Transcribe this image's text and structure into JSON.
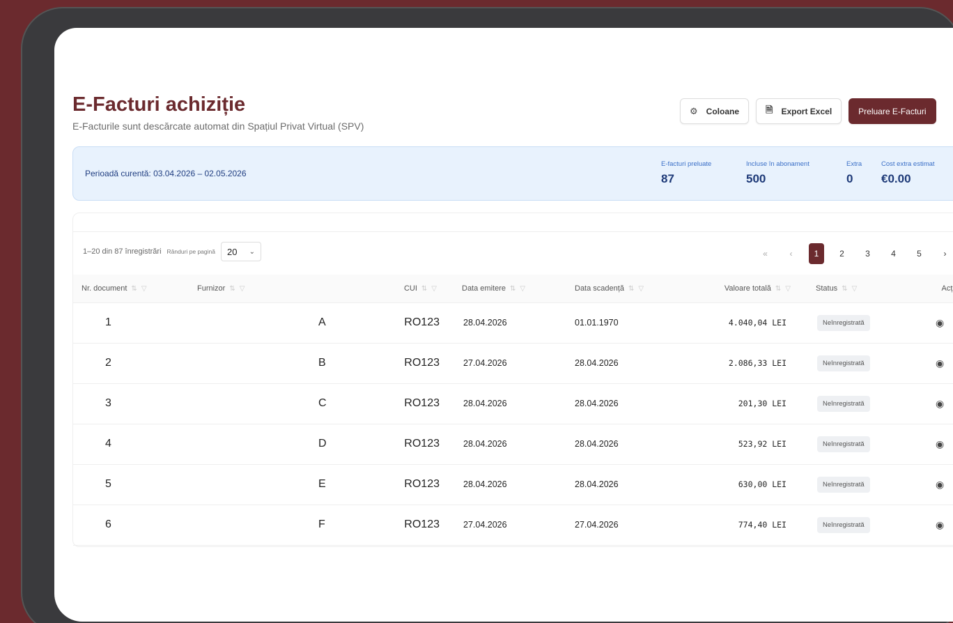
{
  "header": {
    "title": "E-Facturi achiziție",
    "subtitle": "E-Facturile sunt descărcate automat din Spațiul Privat Virtual (SPV)"
  },
  "actions": {
    "columns": "Coloane",
    "export": "Export Excel",
    "fetch": "Preluare E-Facturi"
  },
  "period": {
    "label": "Perioadă curentă: 03.04.2026 – 02.05.2026",
    "stats": [
      {
        "label": "E-facturi preluate",
        "value": "87"
      },
      {
        "label": "Incluse în abonament",
        "value": "500"
      },
      {
        "label": "Extra",
        "value": "0"
      },
      {
        "label": "Cost extra estimat",
        "value": "€0.00"
      }
    ]
  },
  "toolbar": {
    "records": "1–20 din 87 înregistrări",
    "rows_label": "Rânduri pe pagină",
    "rows_value": "20"
  },
  "pagination": {
    "first": "«",
    "prev": "‹",
    "pages": [
      "1",
      "2",
      "3",
      "4",
      "5"
    ],
    "current": "1",
    "next": "›",
    "last": "»"
  },
  "table": {
    "columns": [
      "Nr. document",
      "Furnizor",
      "CUI",
      "Data emitere",
      "Data scadență",
      "Valoare totală",
      "Status",
      "Acțiuni"
    ],
    "rows": [
      {
        "nr": "1",
        "furnizor": "A",
        "cui": "RO123",
        "emitere": "28.04.2026",
        "scadenta": "01.01.1970",
        "valoare": "4.040,04 LEI",
        "status": "Neînregistrată"
      },
      {
        "nr": "2",
        "furnizor": "B",
        "cui": "RO123",
        "emitere": "27.04.2026",
        "scadenta": "28.04.2026",
        "valoare": "2.086,33 LEI",
        "status": "Neînregistrată"
      },
      {
        "nr": "3",
        "furnizor": "C",
        "cui": "RO123",
        "emitere": "28.04.2026",
        "scadenta": "28.04.2026",
        "valoare": "201,30 LEI",
        "status": "Neînregistrată"
      },
      {
        "nr": "4",
        "furnizor": "D",
        "cui": "RO123",
        "emitere": "28.04.2026",
        "scadenta": "28.04.2026",
        "valoare": "523,92 LEI",
        "status": "Neînregistrată"
      },
      {
        "nr": "5",
        "furnizor": "E",
        "cui": "RO123",
        "emitere": "28.04.2026",
        "scadenta": "28.04.2026",
        "valoare": "630,00 LEI",
        "status": "Neînregistrată"
      },
      {
        "nr": "6",
        "furnizor": "F",
        "cui": "RO123",
        "emitere": "27.04.2026",
        "scadenta": "27.04.2026",
        "valoare": "774,40 LEI",
        "status": "Neînregistrată"
      }
    ]
  },
  "colors": {
    "brand": "#6b2a2e",
    "info_bg": "#e8f2fd",
    "info_text": "#1e3a78"
  },
  "icons": {
    "columns": "gear-icon",
    "export": "file-icon",
    "view": "eye-icon",
    "delete": "trash-icon",
    "sort": "sort-icon",
    "filter": "filter-icon"
  }
}
